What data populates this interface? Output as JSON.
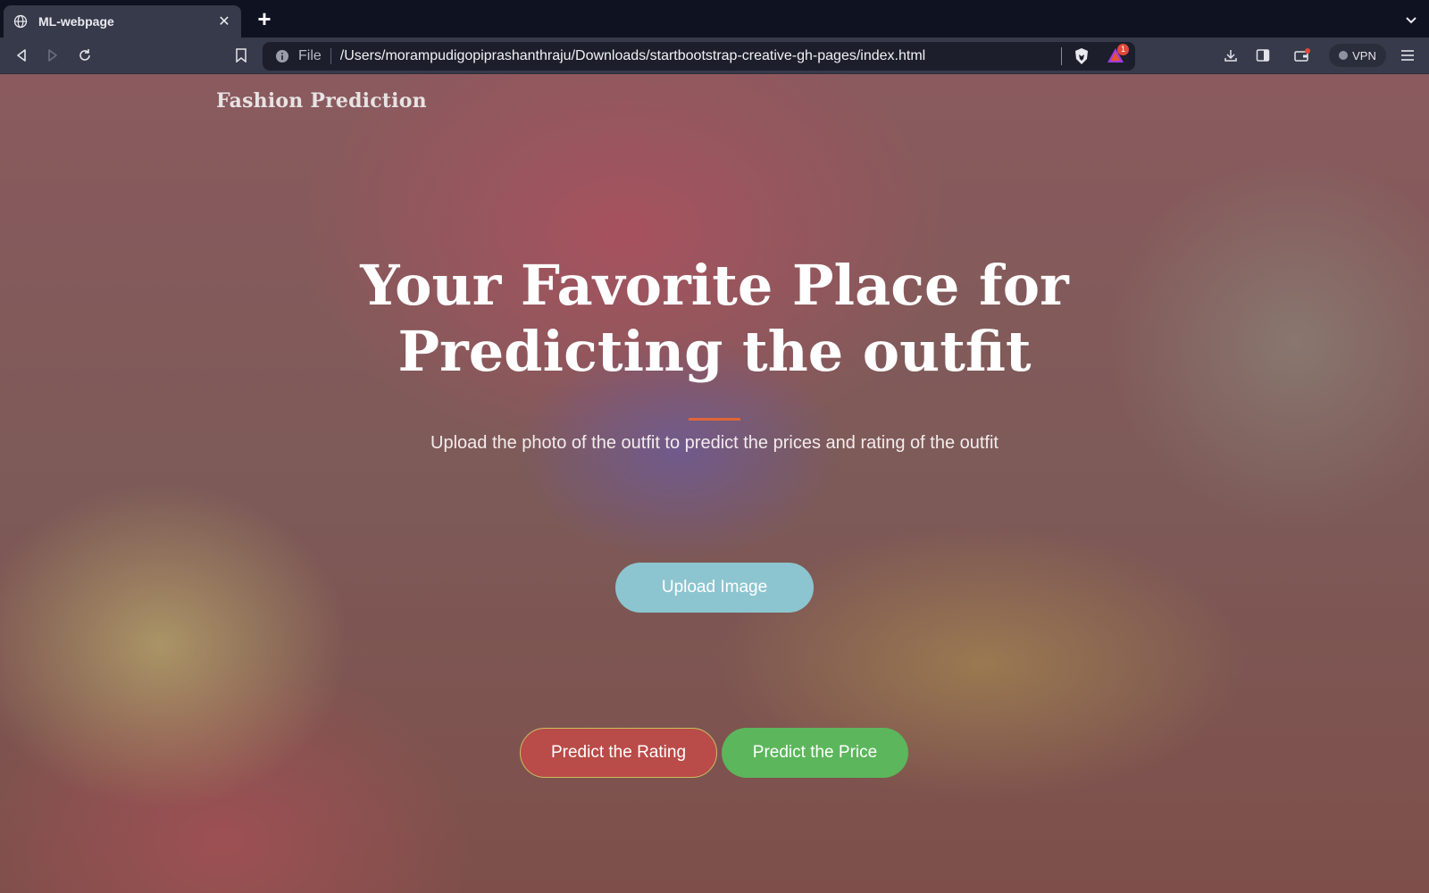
{
  "browser": {
    "tab": {
      "title": "ML-webpage",
      "close_glyph": "✕"
    },
    "new_tab_glyph": "+",
    "address_bar": {
      "scheme_label": "File",
      "url": "/Users/morampudigopiprashanthraju/Downloads/startbootstrap-creative-gh-pages/index.html"
    },
    "rewards_badge": "1",
    "vpn_label": "VPN"
  },
  "page": {
    "brand": "Fashion Prediction",
    "hero_title_line1": "Your Favorite Place for",
    "hero_title_line2": "Predicting the outfit",
    "subtitle": "Upload the photo of the outfit to predict the prices and rating of the outfit",
    "upload_button": "Upload Image",
    "predict_rating_button": "Predict the Rating",
    "predict_price_button": "Predict the Price"
  },
  "colors": {
    "accent_divider": "#e0663a",
    "upload_button": "#8cc5cf",
    "rating_button": "#b94b48",
    "price_button": "#5cb65c"
  }
}
